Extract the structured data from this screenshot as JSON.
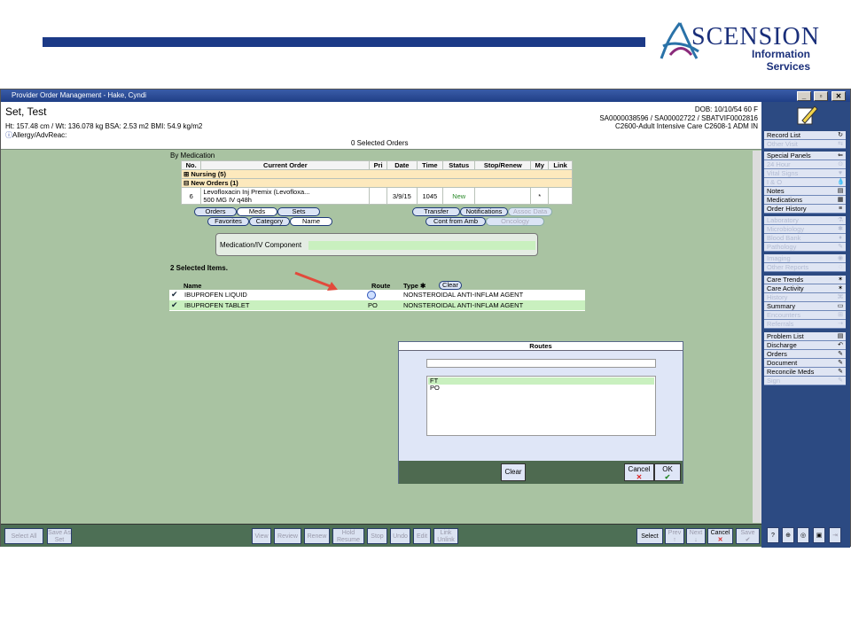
{
  "branding": {
    "logo_text": "SCENSION",
    "logo_sub1": "Information",
    "logo_sub2": "Services"
  },
  "window": {
    "title": "Provider Order Management - Hake, Cyndi",
    "min": "_",
    "max": "▫",
    "close": "✕"
  },
  "patient": {
    "name": "Set, Test",
    "hw": "Ht: 157.48 cm / Wt: 136.078 kg   BSA: 2.53 m2  BMI: 54.9 kg/m2",
    "allergy": "Allergy/AdvReac:",
    "dob": "DOB: 10/10/54 60 F",
    "acct": "SA0000038596 / SA00002722 / SBATVIF0002816",
    "unit": "C2600-Adult Intensive Care C2608-1  ADM IN",
    "selected_orders": "0 Selected Orders"
  },
  "orders": {
    "by_label": "By Medication",
    "headers": [
      "No.",
      "Current Order",
      "Pri",
      "Date",
      "Time",
      "Status",
      "Stop/Renew",
      "My",
      "Link"
    ],
    "group1": "Nursing   (5)",
    "group2": "New Orders   (1)",
    "row": {
      "no": "6",
      "order1": "Levofloxacin Inj Premix (Levofloxa...",
      "order2": "500 MG IV q48h",
      "date": "3/9/15",
      "time": "1045",
      "status": "New",
      "my": "*"
    }
  },
  "tabs": {
    "orders": "Orders",
    "meds": "Meds",
    "sets": "Sets",
    "favorites": "Favorites",
    "category": "Category",
    "name": "Name",
    "transfer": "Transfer",
    "notifications": "Notifications",
    "assoc": "Assoc Data",
    "cont": "Cont from Amb",
    "oncology": "Oncology"
  },
  "med": {
    "label": "Medication/IV Component"
  },
  "selected": {
    "title": "2 Selected Items.",
    "col_name": "Name",
    "col_route": "Route",
    "col_type": "Type ✱",
    "clear": "Clear",
    "items": [
      {
        "name": "IBUPROFEN LIQUID",
        "route": "",
        "type": "NONSTEROIDAL ANTI-INFLAM AGENT"
      },
      {
        "name": "IBUPROFEN TABLET",
        "route": "PO",
        "type": "NONSTEROIDAL ANTI-INFLAM AGENT"
      }
    ]
  },
  "routes": {
    "title": "Routes",
    "options": [
      "FT",
      "PO"
    ],
    "clear": "Clear",
    "cancel": "Cancel",
    "ok": "OK"
  },
  "sidebar": {
    "items": [
      {
        "label": "Record List",
        "dis": false
      },
      {
        "label": "Other Visit",
        "dis": true
      },
      {
        "label": "Special Panels",
        "dis": false
      },
      {
        "label": "24 Hour",
        "dis": true
      },
      {
        "label": "Vital Signs",
        "dis": true
      },
      {
        "label": "I & O",
        "dis": true
      },
      {
        "label": "Notes",
        "dis": false
      },
      {
        "label": "Medications",
        "dis": false
      },
      {
        "label": "Order History",
        "dis": false
      },
      {
        "label": "Laboratory",
        "dis": true
      },
      {
        "label": "Microbiology",
        "dis": true
      },
      {
        "label": "Blood Bank",
        "dis": true
      },
      {
        "label": "Pathology",
        "dis": true
      },
      {
        "label": "Imaging",
        "dis": true
      },
      {
        "label": "Other Reports",
        "dis": true
      },
      {
        "label": "Care Trends",
        "dis": false
      },
      {
        "label": "Care Activity",
        "dis": false
      },
      {
        "label": "History",
        "dis": true
      },
      {
        "label": "Summary",
        "dis": false
      },
      {
        "label": "Encounters",
        "dis": true
      },
      {
        "label": "Referrals",
        "dis": true
      },
      {
        "label": "Problem List",
        "dis": false
      },
      {
        "label": "Discharge",
        "dis": false
      },
      {
        "label": "Orders",
        "dis": false
      },
      {
        "label": "Document",
        "dis": false
      },
      {
        "label": "Reconcile Meds",
        "dis": false
      },
      {
        "label": "Sign",
        "dis": true
      }
    ]
  },
  "bottom": {
    "select_all": "Select All",
    "save_as_set": "Save As Set",
    "view": "View",
    "review": "Review",
    "renew": "Renew",
    "hold": "Hold Resume",
    "stop": "Stop",
    "undo": "Undo",
    "edit": "Edit",
    "link": "Link Unlink",
    "select": "Select",
    "prev": "Prev",
    "next": "Next",
    "cancel": "Cancel",
    "save": "Save"
  }
}
